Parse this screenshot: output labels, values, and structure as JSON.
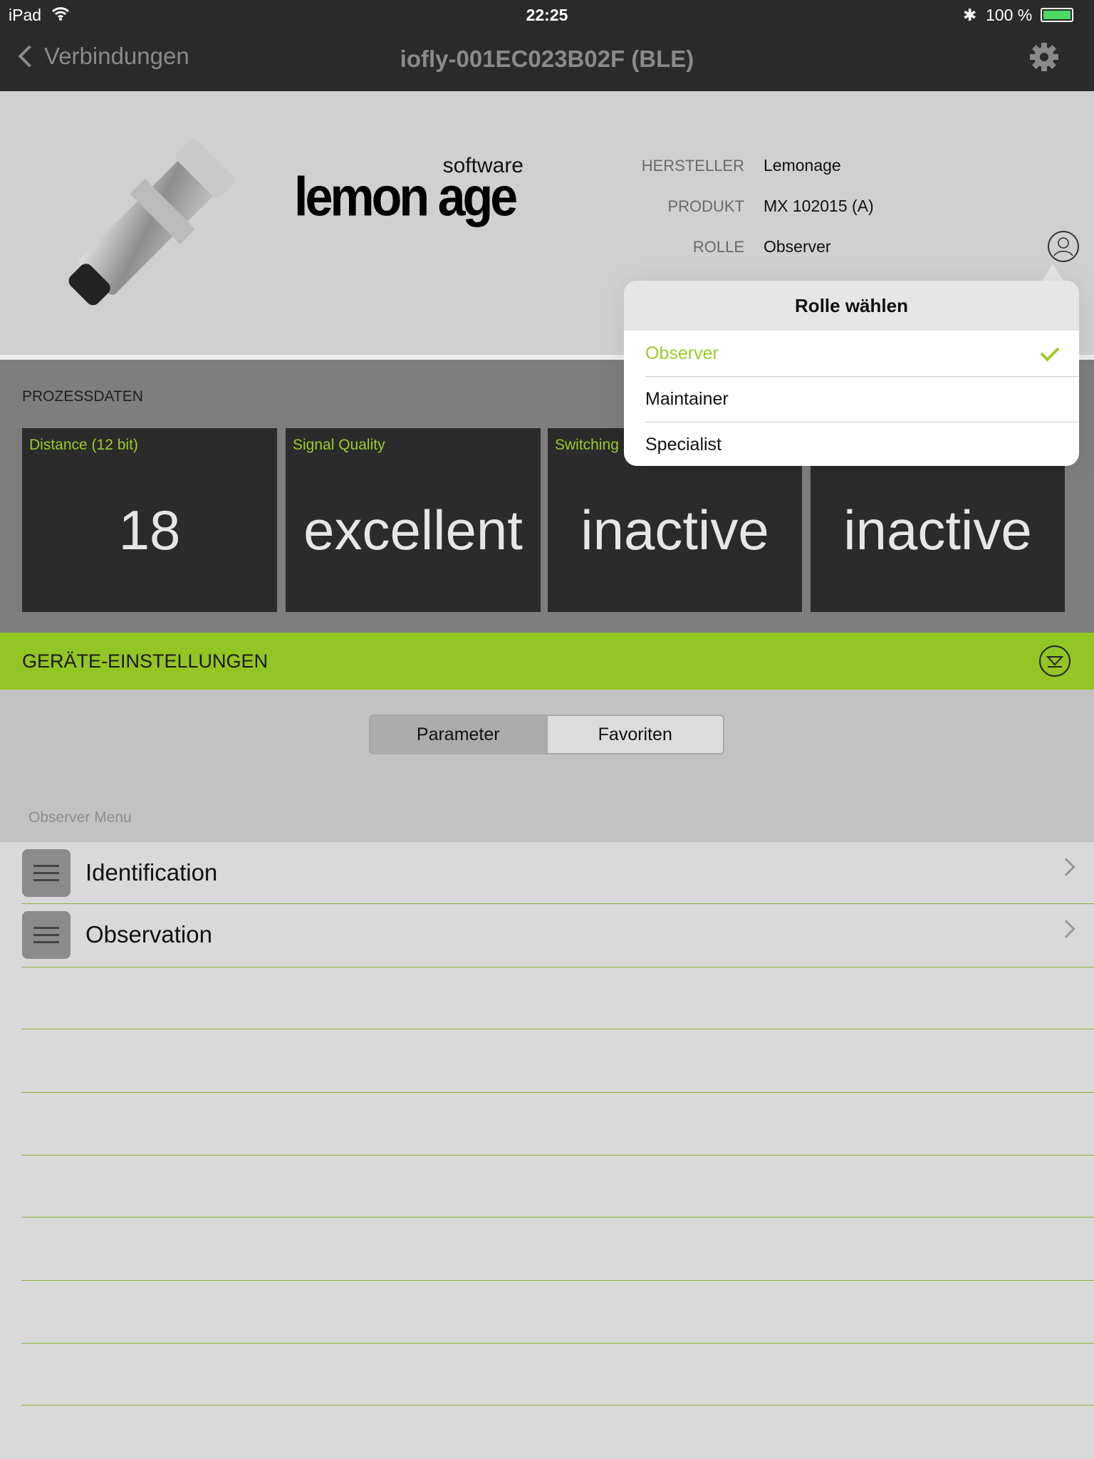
{
  "status_bar": {
    "device": "iPad",
    "time": "22:25",
    "battery": "100 %"
  },
  "nav": {
    "back_label": "Verbindungen",
    "title": "iofly-001EC023B02F (BLE)"
  },
  "device_info": {
    "logo_small": "software",
    "logo_main": "lemon age",
    "fields": [
      {
        "label": "HERSTELLER",
        "value": "Lemonage"
      },
      {
        "label": "PRODUKT",
        "value": "MX 102015 (A)"
      },
      {
        "label": "ROLLE",
        "value": "Observer"
      }
    ]
  },
  "process": {
    "title": "PROZESSDATEN",
    "tiles": [
      {
        "title": "Distance (12 bit)",
        "value": "18"
      },
      {
        "title": "Signal Quality",
        "value": "excellent"
      },
      {
        "title": "Switching",
        "value": "inactive"
      },
      {
        "title": "",
        "value": "inactive"
      }
    ]
  },
  "settings": {
    "title": "GERÄTE-EINSTELLUNGEN",
    "segments": [
      "Parameter",
      "Favoriten"
    ],
    "selected_segment": "Parameter",
    "menu_title": "Observer Menu",
    "items": [
      {
        "label": "Identification"
      },
      {
        "label": "Observation"
      }
    ]
  },
  "role_popover": {
    "title": "Rolle wählen",
    "options": [
      "Observer",
      "Maintainer",
      "Specialist"
    ],
    "selected": "Observer"
  },
  "colors": {
    "accent": "#93c524",
    "bar": "#2a2a2a",
    "tile": "#2b2b2b"
  }
}
